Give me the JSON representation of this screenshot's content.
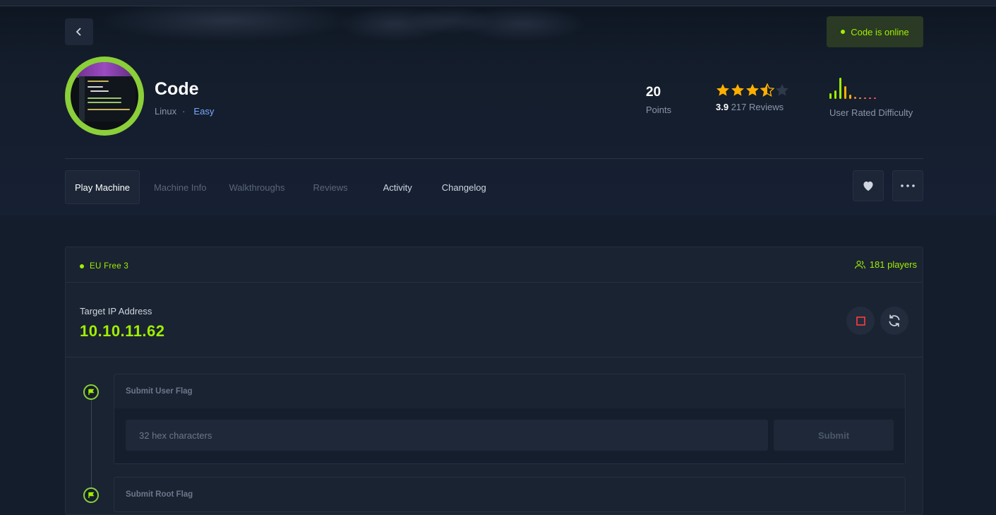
{
  "machine": {
    "name": "Code",
    "os": "Linux",
    "separator": "·",
    "difficulty": "Easy",
    "status": "Code is online"
  },
  "stats": {
    "points_value": "20",
    "points_label": "Points",
    "rating_value": "3.9",
    "reviews_label": "217 Reviews",
    "rating_fraction": 0.78,
    "difficulty_label": "User Rated Difficulty"
  },
  "tabs": [
    {
      "label": "Play Machine"
    },
    {
      "label": "Machine Info"
    },
    {
      "label": "Walkthroughs"
    },
    {
      "label": "Reviews"
    },
    {
      "label": "Activity"
    },
    {
      "label": "Changelog"
    }
  ],
  "server": {
    "name": "EU Free 3",
    "players": "181 players"
  },
  "target": {
    "label": "Target IP Address",
    "ip": "10.10.11.62"
  },
  "flags": {
    "user_title": "Submit User Flag",
    "root_title": "Submit Root Flag",
    "placeholder": "32 hex characters",
    "submit_label": "Submit"
  },
  "colors": {
    "accent": "#9fef00",
    "star": "#ffaf00",
    "stop": "#ff3e3e",
    "link": "#7aa7ff"
  },
  "icons": {
    "back": "chevron-left-icon",
    "favorite": "heart-icon",
    "more": "more-horizontal-icon",
    "players": "users-icon",
    "stop": "stop-icon",
    "reset": "refresh-icon",
    "flag": "flag-icon"
  }
}
